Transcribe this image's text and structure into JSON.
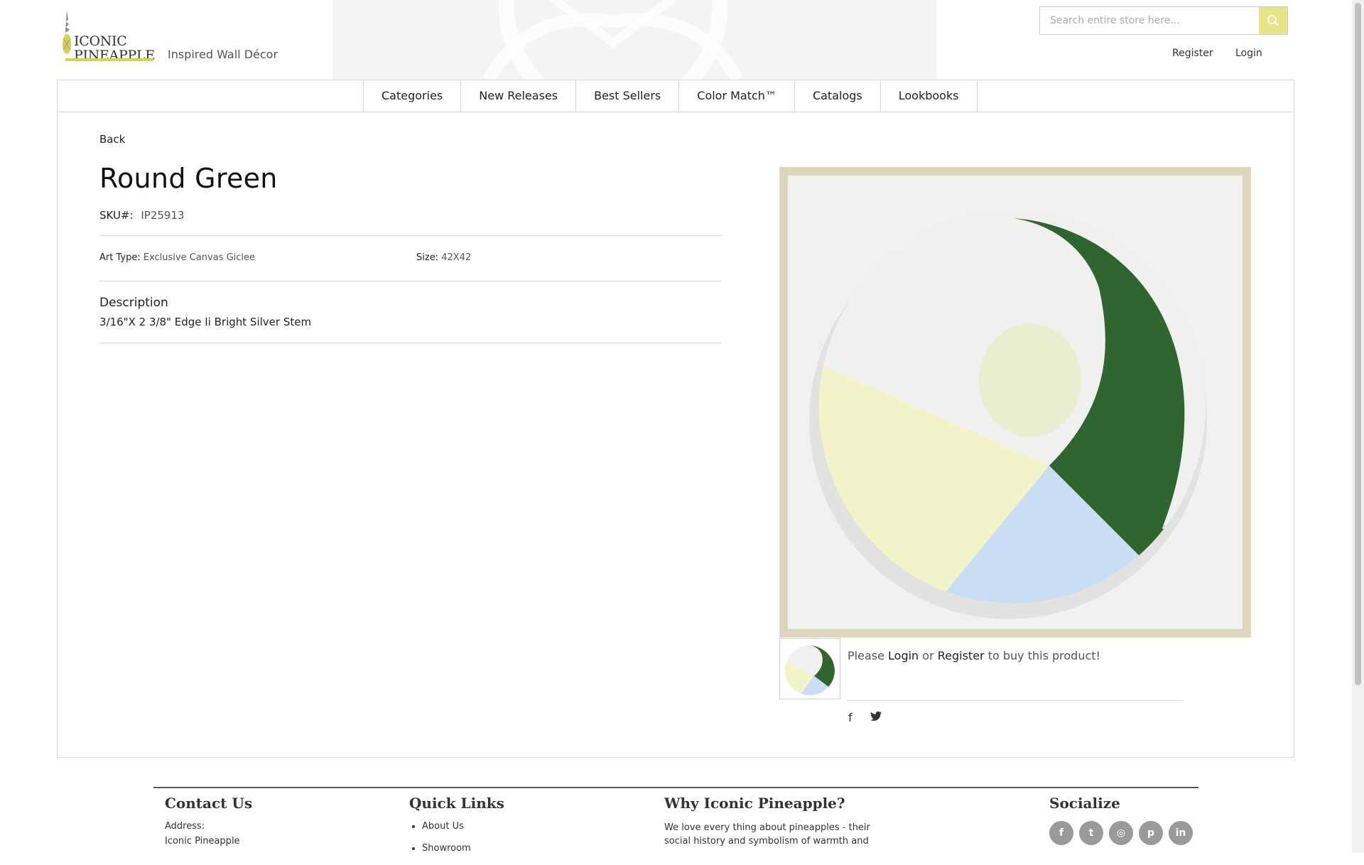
{
  "header": {
    "logo_line1": "ICONIC",
    "logo_line2": "PINEAPPLE",
    "tagline": "Inspired Wall Décor",
    "search_placeholder": "Search entire store here...",
    "register": "Register",
    "login": "Login"
  },
  "nav": {
    "items": [
      {
        "label": "Categories"
      },
      {
        "label": "New Releases"
      },
      {
        "label": "Best Sellers"
      },
      {
        "label": "Color Match™"
      },
      {
        "label": "Catalogs"
      },
      {
        "label": "Lookbooks"
      }
    ]
  },
  "product": {
    "back": "Back",
    "title": "Round Green",
    "sku_label": "SKU#:",
    "sku": "IP25913",
    "art_type_label": "Art Type:",
    "art_type": "Exclusive Canvas Giclee",
    "size_label": "Size:",
    "size": "42X42",
    "description_title": "Description",
    "description": "3/16\"X 2 3/8\" Edge Ii Bright Silver Stem",
    "buy_prefix": "Please",
    "buy_login": "Login",
    "buy_or": "or",
    "buy_register": "Register",
    "buy_suffix": "to buy this product!"
  },
  "share": {
    "facebook": "f",
    "twitter_icon": "twitter-icon"
  },
  "footer": {
    "contact_title": "Contact Us",
    "address_label": "Address:",
    "address_line1": "Iconic Pineapple",
    "quick_title": "Quick Links",
    "quick_links": [
      {
        "label": "About Us"
      },
      {
        "label": "Showroom"
      }
    ],
    "why_title": "Why Iconic Pineapple?",
    "why_text": "We love every thing about pineapples - their social history and symbolism of warmth and",
    "social_title": "Socialize",
    "social": [
      {
        "icon": "facebook-icon",
        "glyph": "f"
      },
      {
        "icon": "twitter-icon",
        "glyph": "t"
      },
      {
        "icon": "instagram-icon",
        "glyph": "◎"
      },
      {
        "icon": "pinterest-icon",
        "glyph": "p"
      },
      {
        "icon": "linkedin-icon",
        "glyph": "in"
      }
    ]
  },
  "colors": {
    "accent_yellow": "#e7e58a",
    "logo_yellow": "#d6d24a",
    "painting_green": "#2f6630",
    "painting_yellow": "#f2f3c9",
    "painting_blue": "#c9ddf5",
    "frame": "#dcd6bd"
  }
}
